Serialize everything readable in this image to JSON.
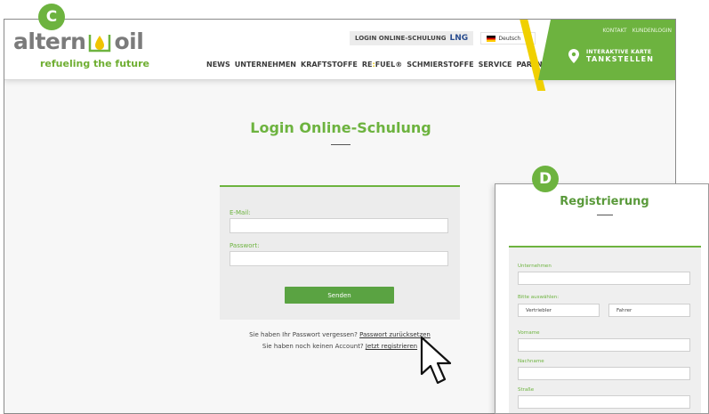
{
  "badges": {
    "left": "C",
    "right": "D"
  },
  "header": {
    "logo_left": "altern",
    "logo_right": "oil",
    "tagline": "refueling the future",
    "lng_label": "LOGIN ONLINE-SCHULUNG",
    "lng_code": "LNG",
    "language": "Deutsch",
    "nav": [
      "NEWS",
      "UNTERNEHMEN",
      "KRAFTSTOFFE",
      "SCHMIERSTOFFE",
      "SERVICE",
      "PARTNER"
    ],
    "refuel_a": "RE",
    "refuel_b": ":",
    "refuel_c": "FUEL®",
    "links": [
      "KONTAKT",
      "KUNDENLOGIN"
    ],
    "map_line1": "INTERAKTIVE KARTE",
    "map_line2": "TANKSTELLEN"
  },
  "login": {
    "title": "Login Online-Schulung",
    "email_label": "E-Mail:",
    "password_label": "Passwort:",
    "submit": "Senden",
    "forgot_text": "Sie haben Ihr Passwort vergessen?",
    "forgot_link": "Passwort zurücksetzen",
    "noaccount_text": "Sie haben noch keinen Account?",
    "register_link": "Jetzt registrieren"
  },
  "registration": {
    "title": "Registrierung",
    "company_label": "Unternehmen",
    "select_label": "Bitte auswählen:",
    "option_1": "Vertriebler",
    "option_2": "Fahrer",
    "firstname_label": "Vorname",
    "lastname_label": "Nachname",
    "street_label": "Straße"
  },
  "colors": {
    "brand_green": "#6db33f",
    "accent_yellow": "#f0d000",
    "logo_gray": "#7b7b7b"
  }
}
